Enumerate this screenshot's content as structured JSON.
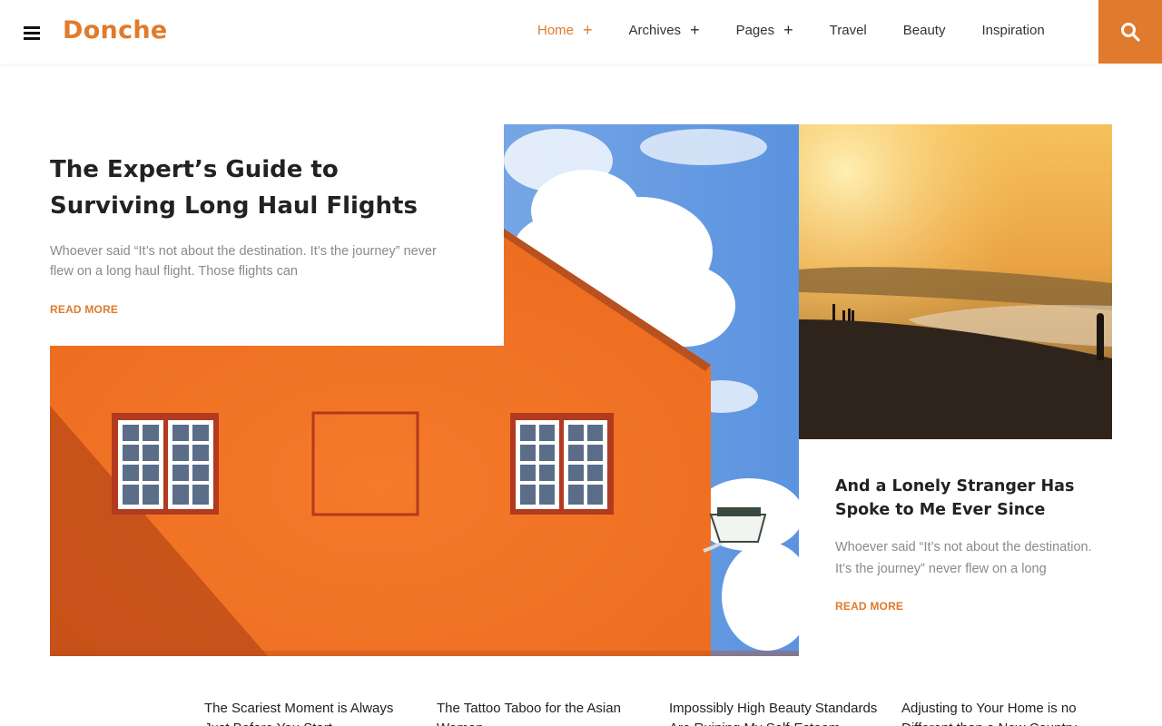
{
  "brand": {
    "logo": "Donche",
    "accent": "#e07a2c"
  },
  "nav": {
    "items": [
      {
        "label": "Home",
        "plus": "+"
      },
      {
        "label": "Archives",
        "plus": "+"
      },
      {
        "label": "Pages",
        "plus": "+"
      },
      {
        "label": "Travel",
        "plus": ""
      },
      {
        "label": "Beauty",
        "plus": ""
      },
      {
        "label": "Inspiration",
        "plus": ""
      }
    ],
    "active": "Home",
    "search_icon": "search-icon",
    "menu_icon": "hamburger-icon"
  },
  "hero": {
    "title": "The Expert’s Guide to Surviving Long Haul Flights",
    "excerpt": "Whoever said “It’s not about the destination. It’s the journey” never flew on a long haul flight. Those flights can",
    "read_more": "READ MORE"
  },
  "side_post": {
    "title": "And a Lonely Stranger Has Spoke to Me Ever Since",
    "excerpt": "Whoever said “It’s not about the destination. It’s the journey” never flew on a long",
    "read_more": "READ MORE"
  },
  "bottom_posts": [
    "The Scariest Moment is Always Just Before You Start",
    "The Tattoo Taboo for the Asian Women",
    "Impossibly High Beauty Standards Are Ruining My Self-Esteem",
    "Adjusting to Your Home is no Different than a New Country"
  ]
}
